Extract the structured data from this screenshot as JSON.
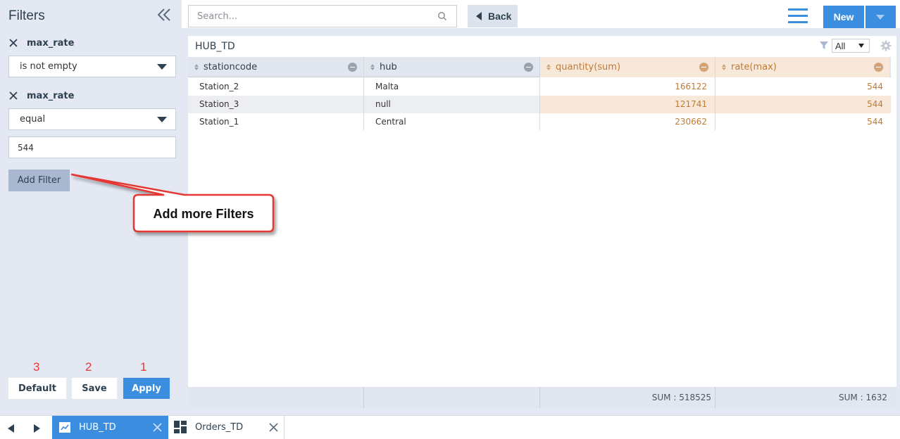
{
  "sidebar": {
    "title": "Filters",
    "filters": [
      {
        "field": "max_rate",
        "operator": "is not empty"
      },
      {
        "field": "max_rate",
        "operator": "equal",
        "value": "544"
      }
    ],
    "add_filter_label": "Add Filter",
    "buttons": [
      {
        "label": "Default",
        "number": "3"
      },
      {
        "label": "Save",
        "number": "2"
      },
      {
        "label": "Apply",
        "number": "1"
      }
    ]
  },
  "toolbar": {
    "search_placeholder": "Search...",
    "back_label": "Back",
    "new_label": "New"
  },
  "panel": {
    "title": "HUB_TD",
    "filter_select": "All",
    "columns": [
      {
        "label": "stationcode"
      },
      {
        "label": "hub"
      },
      {
        "label": "quantity(sum)"
      },
      {
        "label": "rate(max)"
      }
    ],
    "rows": [
      [
        "Station_2",
        "Malta",
        "166122",
        "544"
      ],
      [
        "Station_3",
        "null",
        "121741",
        "544"
      ],
      [
        "Station_1",
        "Central",
        "230662",
        "544"
      ]
    ],
    "footer": {
      "quantity_sum": "SUM : 518525",
      "rate_sum": "SUM : 1632"
    }
  },
  "tabs": [
    {
      "label": "HUB_TD",
      "active": true
    },
    {
      "label": "Orders_TD",
      "active": false
    }
  ],
  "callout": {
    "text": "Add more Filters"
  },
  "colors": {
    "accent": "#3b8de0",
    "sidebar_bg": "#e3e8f2",
    "measure_header": "#f8e8d9",
    "measure_text": "#c07a33",
    "annotation_red": "#e53935"
  }
}
